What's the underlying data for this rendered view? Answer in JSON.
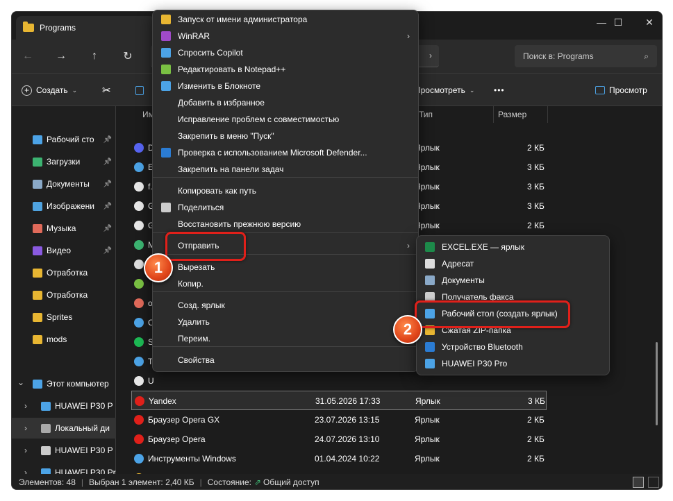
{
  "window": {
    "title": "Programs",
    "minimize": "—",
    "maximize": "☐",
    "close": "✕"
  },
  "nav": {
    "back": "←",
    "forward": "→",
    "up": "↑",
    "refresh": "↻",
    "address_tail": "›"
  },
  "search": {
    "placeholder": "Поиск в: Programs",
    "icon": "⌕"
  },
  "toolbar": {
    "create": "Создать",
    "view": "Просмотреть",
    "more": "•••",
    "preview": "Просмотр"
  },
  "sidebar": {
    "items": [
      {
        "label": "Рабочий сто",
        "color": "#4ca3e6",
        "pinned": true
      },
      {
        "label": "Загрузки",
        "color": "#3cb371",
        "pinned": true
      },
      {
        "label": "Документы",
        "color": "#8aa9c8",
        "pinned": true
      },
      {
        "label": "Изображени",
        "color": "#4fa3e0",
        "pinned": true
      },
      {
        "label": "Музыка",
        "color": "#e06a5a",
        "pinned": true
      },
      {
        "label": "Видео",
        "color": "#8a5ae0",
        "pinned": true
      },
      {
        "label": "Отработка",
        "color": "#e8b632",
        "pinned": false
      },
      {
        "label": "Отработка",
        "color": "#e8b632",
        "pinned": false
      },
      {
        "label": "Sprites",
        "color": "#e8b632",
        "pinned": false
      },
      {
        "label": "mods",
        "color": "#e8b632",
        "pinned": false
      },
      {
        "label": "Этот компьютер",
        "color": "#4ca3e6",
        "pinned": false
      },
      {
        "label": "HUAWEI P30 P",
        "color": "#4ca3e6",
        "pinned": false
      },
      {
        "label": "Локальный ди",
        "color": "#aaaaaa",
        "pinned": false
      },
      {
        "label": "HUAWEI P30 P",
        "color": "#cccccc",
        "pinned": false
      },
      {
        "label": "HUAWEI P30 Pro",
        "color": "#4ca3e6",
        "pinned": false
      }
    ]
  },
  "columns": {
    "name": "Имя",
    "type": "Тип",
    "size": "Размер"
  },
  "rows": [
    {
      "name": "D",
      "date": "",
      "type": "Ярлык",
      "size": "2 КБ",
      "color": "#5865f2"
    },
    {
      "name": "E",
      "date": "",
      "type": "Ярлык",
      "size": "3 КБ",
      "color": "#4ca3e6"
    },
    {
      "name": "f.",
      "date": "",
      "type": "Ярлык",
      "size": "3 КБ",
      "color": "#e8e8e8"
    },
    {
      "name": "G",
      "date": "",
      "type": "Ярлык",
      "size": "3 КБ",
      "color": "#e8e8e8"
    },
    {
      "name": "G",
      "date": "",
      "type": "Ярлык",
      "size": "2 КБ",
      "color": "#e8e8e8"
    },
    {
      "name": "M",
      "date": "",
      "type": "Ярлык",
      "size": "2 КБ",
      "color": "#3cb371"
    },
    {
      "name": "N",
      "date": "",
      "type": "",
      "size": "",
      "color": "#dddddd"
    },
    {
      "name": "",
      "date": "",
      "type": "",
      "size": "",
      "color": "#7ac043"
    },
    {
      "name": "o",
      "date": "",
      "type": "",
      "size": "",
      "color": "#e06a5a"
    },
    {
      "name": "C",
      "date": "",
      "type": "",
      "size": "",
      "color": "#4ca3e6"
    },
    {
      "name": "S",
      "date": "",
      "type": "",
      "size": "",
      "color": "#1db954"
    },
    {
      "name": "T",
      "date": "",
      "type": "",
      "size": "",
      "color": "#4ca3e6"
    },
    {
      "name": "U",
      "date": "",
      "type": "",
      "size": "",
      "color": "#e8e8e8"
    },
    {
      "name": "Yandex",
      "date": "31.05.2026 17:33",
      "type": "Ярлык",
      "size": "3 КБ",
      "color": "#e0201a"
    },
    {
      "name": "Браузер Opera GX",
      "date": "23.07.2026 13:15",
      "type": "Ярлык",
      "size": "2 КБ",
      "color": "#e0201a"
    },
    {
      "name": "Браузер Opera",
      "date": "24.07.2026 13:10",
      "type": "Ярлык",
      "size": "2 КБ",
      "color": "#e0201a"
    },
    {
      "name": "Инструменты Windows",
      "date": "01.04.2024 10:22",
      "type": "Ярлык",
      "size": "2 КБ",
      "color": "#4ca3e6"
    },
    {
      "name": "Проводник",
      "date": "01.04.2024 10:22",
      "type": "Ярлык",
      "size": "1 КБ",
      "color": "#e8b632"
    }
  ],
  "status": {
    "count": "Элементов: 48",
    "selected": "Выбран 1 элемент: 2,40 КБ",
    "state": "Состояние:",
    "share": "Общий доступ"
  },
  "menu": {
    "items": [
      {
        "label": "Запуск от имени администратора",
        "color": "#e8b632"
      },
      {
        "label": "WinRAR",
        "color": "#a04ac8",
        "arrow": "›"
      },
      {
        "label": "Спросить Copilot",
        "color": "#4ca3e6"
      },
      {
        "label": "Редактировать в Notepad++",
        "color": "#7ac043"
      },
      {
        "label": "Изменить в Блокноте",
        "color": "#4ca3e6"
      },
      {
        "label": "Добавить в избранное",
        "color": ""
      },
      {
        "label": "Исправление проблем с совместимостью",
        "color": ""
      },
      {
        "label": "Закрепить в меню \"Пуск\"",
        "color": ""
      },
      {
        "label": "Проверка с использованием Microsoft Defender...",
        "color": "#2b7cd3"
      },
      {
        "label": "Закрепить на панели задач",
        "color": ""
      },
      {
        "label": "Копировать как путь",
        "color": ""
      },
      {
        "label": "Поделиться",
        "color": "#cccccc"
      },
      {
        "label": "Восстановить прежнюю версию",
        "color": ""
      },
      {
        "label": "Отправить",
        "color": "",
        "arrow": "›"
      },
      {
        "label": "Вырезать",
        "color": ""
      },
      {
        "label": "Копир.",
        "color": ""
      },
      {
        "label": "Созд. ярлык",
        "color": ""
      },
      {
        "label": "Удалить",
        "color": ""
      },
      {
        "label": "Переим.",
        "color": ""
      },
      {
        "label": "Свойства",
        "color": ""
      }
    ]
  },
  "submenu": {
    "items": [
      {
        "label": "EXCEL.EXE — ярлык",
        "color": "#1d8a4a"
      },
      {
        "label": "Адресат",
        "color": "#dddddd"
      },
      {
        "label": "Документы",
        "color": "#8aa9c8"
      },
      {
        "label": "Получатель факса",
        "color": "#cccccc"
      },
      {
        "label": "Рабочий стол (создать ярлык)",
        "color": "#4ca3e6"
      },
      {
        "label": "Сжатая ZIP-папка",
        "color": "#e8b632"
      },
      {
        "label": "Устройство Bluetooth",
        "color": "#2b7cd3"
      },
      {
        "label": "HUAWEI P30 Pro",
        "color": "#4ca3e6"
      }
    ]
  },
  "badges": {
    "one": "1",
    "two": "2"
  }
}
